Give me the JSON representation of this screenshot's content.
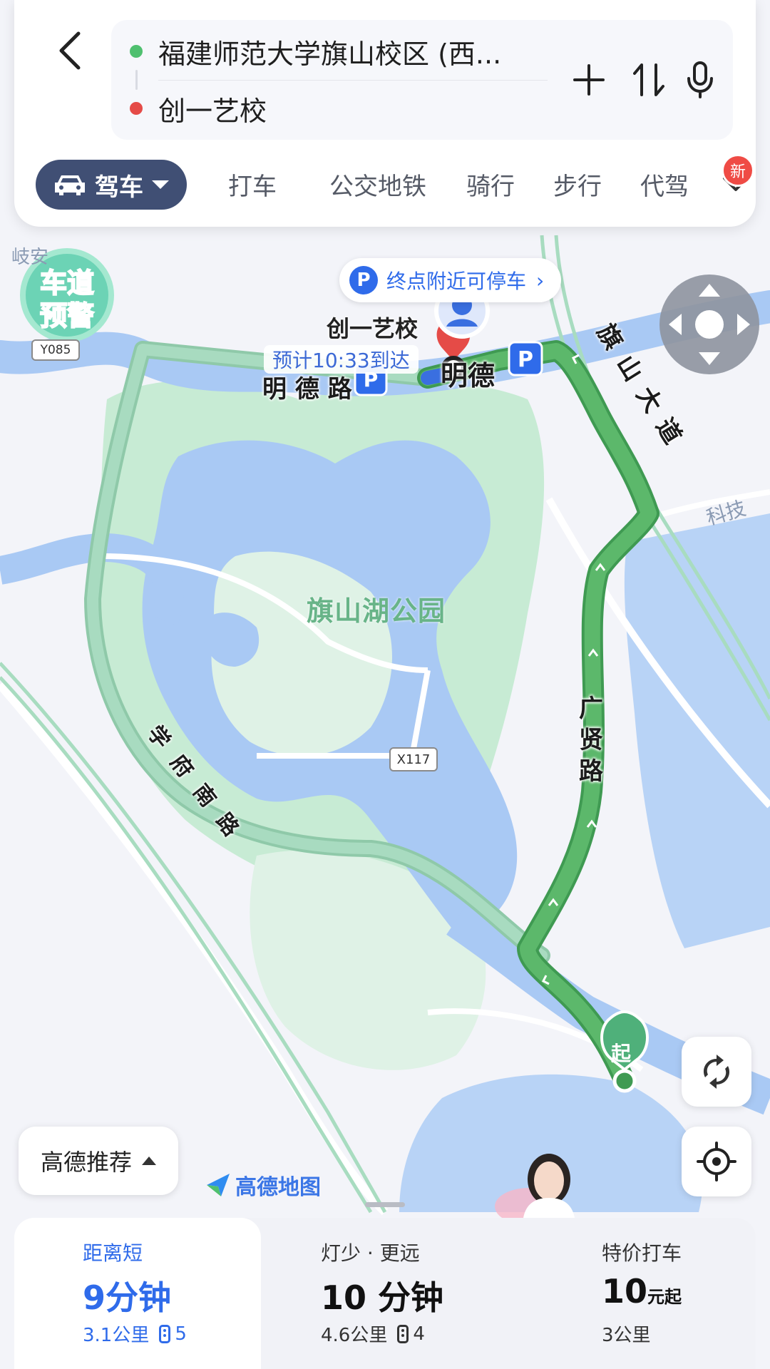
{
  "colors": {
    "route": "#5cb86b",
    "route_alt": "#a8dbc0",
    "water": "#a9c9f4",
    "park": "#c7ebd4",
    "accent": "#2f6bea",
    "drive_pill": "#404f74",
    "origin_dot": "#4fc06f",
    "dest_dot": "#e54b47"
  },
  "header": {
    "back_icon": "chevron-left-icon",
    "origin": "福建师范大学旗山校区 (西...",
    "destination": "创一艺校",
    "add_icon": "plus-icon",
    "swap_icon": "swap-icon",
    "voice_icon": "microphone-icon"
  },
  "modes": {
    "active": "驾车",
    "items": [
      "打车",
      "公交地铁",
      "骑行",
      "步行",
      "代驾"
    ],
    "badge": "新"
  },
  "map": {
    "lane_warning": [
      "车道",
      "预警"
    ],
    "parking_hint": "终点附近可停车",
    "parking_icon": "P",
    "destination_label": "创一艺校",
    "eta": "预计10:33到达",
    "roads": {
      "mingde": [
        "明",
        "德",
        "路"
      ],
      "qishan": [
        "旗",
        "山",
        "大",
        "道"
      ],
      "guangxian": [
        "广",
        "贤",
        "路"
      ],
      "xuefu": [
        "学",
        "府",
        "南",
        "路"
      ]
    },
    "park_name": "旗山湖公园",
    "route_badges": [
      "X117",
      "Y085"
    ],
    "place_fragments": [
      "科技",
      "岐安"
    ],
    "start_marker": "起"
  },
  "controls": {
    "recommend": "高德推荐",
    "logo": "高德地图",
    "refresh_icon": "refresh-icon",
    "locate_icon": "locate-icon"
  },
  "routes": [
    {
      "tag": "距离短",
      "time_num": "9",
      "time_unit": "分钟",
      "distance": "3.1公里",
      "lights": "5"
    },
    {
      "tag": "灯少 · 更远",
      "time_num": "10",
      "time_unit": "分钟",
      "distance": "4.6公里",
      "lights": "4"
    },
    {
      "tag": "特价打车",
      "time_num": "10",
      "time_unit": "元起",
      "distance": "3公里"
    }
  ]
}
